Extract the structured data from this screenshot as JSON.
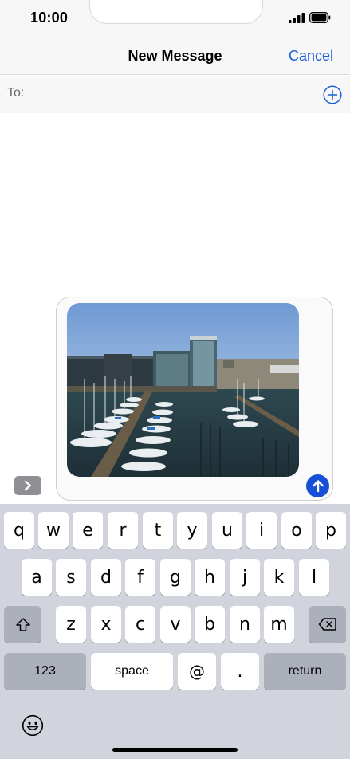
{
  "status_bar": {
    "time": "10:00"
  },
  "nav": {
    "title": "New Message",
    "cancel_label": "Cancel"
  },
  "to_row": {
    "label": "To:"
  },
  "colors": {
    "accent": "#1a5fd3",
    "send": "#1650d6",
    "keyboard_bg": "#d1d4dc"
  },
  "keyboard": {
    "row1": [
      "q",
      "w",
      "e",
      "r",
      "t",
      "y",
      "u",
      "i",
      "o",
      "p"
    ],
    "row2": [
      "a",
      "s",
      "d",
      "f",
      "g",
      "h",
      "j",
      "k",
      "l"
    ],
    "row3": [
      "z",
      "x",
      "c",
      "v",
      "b",
      "n",
      "m"
    ],
    "numbers_label": "123",
    "space_label": "space",
    "at_label": "@",
    "period_label": ".",
    "return_label": "return"
  },
  "icons": [
    "plus-circle-icon",
    "chevron-right-icon",
    "arrow-up-icon",
    "shift-icon",
    "backspace-icon",
    "emoji-icon",
    "signal-icon",
    "battery-icon"
  ]
}
